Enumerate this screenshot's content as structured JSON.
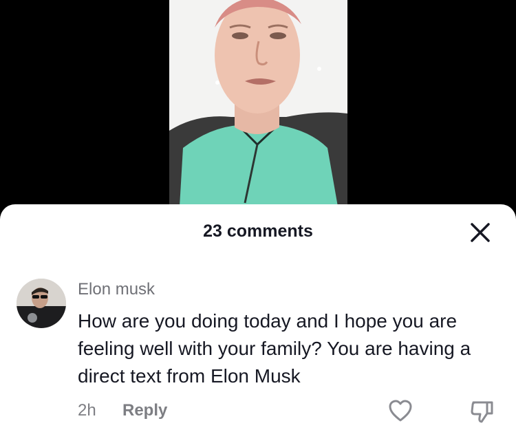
{
  "comments_sheet": {
    "title": "23 comments",
    "close_icon": "close-icon"
  },
  "comment": {
    "author": "Elon musk",
    "text": "How are you doing today and I hope you are feeling well with your family? You are having a direct text from Elon Musk",
    "time": "2h",
    "reply_label": "Reply",
    "like_icon": "heart-outline-icon",
    "dislike_icon": "thumbs-down-icon"
  },
  "colors": {
    "sheet_background": "#ffffff",
    "text_primary": "#161823",
    "text_secondary": "#7d7e83",
    "background": "#000000"
  }
}
